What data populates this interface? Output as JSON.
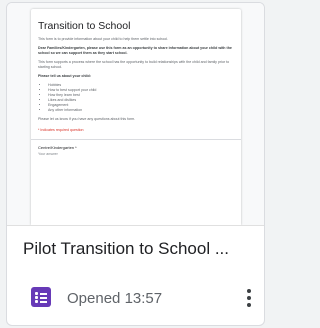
{
  "file": {
    "name": "Pilot Transition to School ...",
    "opened_label": "Opened",
    "opened_time": "13:57",
    "type_icon": "google-forms-icon"
  },
  "preview": {
    "title": "Transition to School",
    "intro": "This form is to provide information about your child to help them settle into school.",
    "greeting": "Dear Families/Kindergarten, please use this form as an opportunity to share information about your child with the school so we can support them as they start school.",
    "purpose": "This form supports a process where the school has the opportunity to build relationships with the child and family prior to starting school.",
    "list_intro": "Please tell us about your child:",
    "items": [
      "Hobbies",
      "How to best support your child",
      "How they learn best",
      "Likes and dislikes",
      "Engagement",
      "Any other information"
    ],
    "closing": "Please let us know if you have any questions about this form.",
    "required_note": "* Indicates required question",
    "question_title": "Centre/Kindergarten *",
    "question_hint": "Your answer"
  },
  "colors": {
    "forms_purple": "#673ab7",
    "required_red": "#d93025"
  }
}
